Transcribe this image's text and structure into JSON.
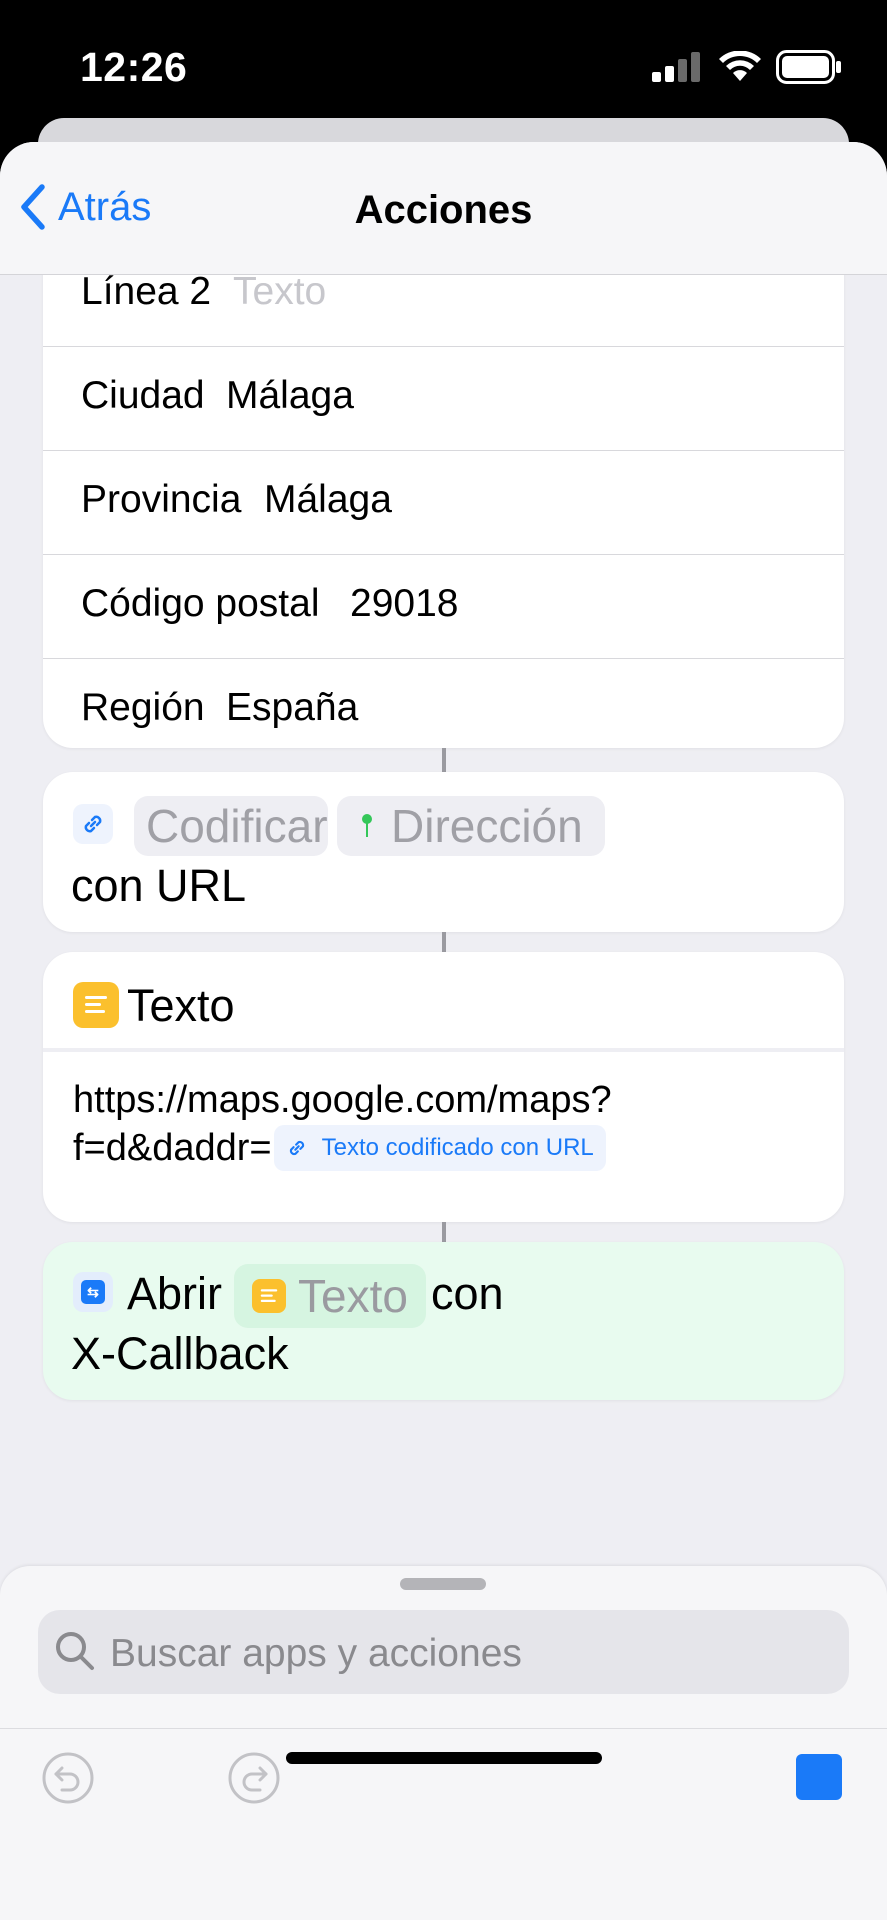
{
  "status_bar": {
    "time": "12:26"
  },
  "nav": {
    "back_label": "Atrás",
    "title": "Acciones"
  },
  "address_card": {
    "rows": [
      {
        "label": "Línea 2",
        "value": "Texto",
        "is_placeholder": true
      },
      {
        "label": "Ciudad",
        "value": "Málaga"
      },
      {
        "label": "Provincia",
        "value": "Málaga"
      },
      {
        "label": "Código postal",
        "value": "29018"
      },
      {
        "label": "Región",
        "value": "España"
      }
    ]
  },
  "url_encode_action": {
    "op_chip": "Codificar",
    "input_chip": "Dirección",
    "suffix": "con URL"
  },
  "text_action": {
    "title": "Texto",
    "body_line1": "https://maps.google.com/maps?",
    "body_line2": "f=d&daddr=",
    "variable_chip": "Texto codificado con URL"
  },
  "xcallback_action": {
    "verb": "Abrir",
    "chip": "Texto",
    "connector": "con",
    "suffix": "X-Callback"
  },
  "search": {
    "placeholder": "Buscar apps y acciones"
  },
  "colors": {
    "accent": "#1a7af8",
    "text_icon": "#fbc02d",
    "xcallback_bg": "#e8fbef",
    "pin": "#34c759"
  }
}
